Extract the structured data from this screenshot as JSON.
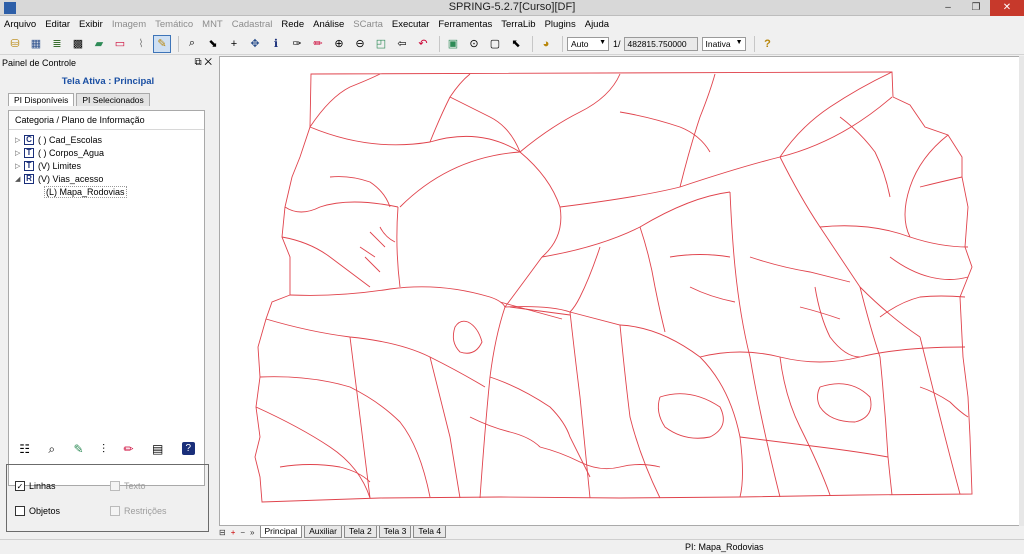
{
  "window": {
    "title": "SPRING-5.2.7[Curso][DF]",
    "min": "–",
    "max": "❐",
    "close": "✕"
  },
  "menu": [
    {
      "label": "Arquivo",
      "enabled": true
    },
    {
      "label": "Editar",
      "enabled": true
    },
    {
      "label": "Exibir",
      "enabled": true
    },
    {
      "label": "Imagem",
      "enabled": false
    },
    {
      "label": "Temático",
      "enabled": false
    },
    {
      "label": "MNT",
      "enabled": false
    },
    {
      "label": "Cadastral",
      "enabled": false
    },
    {
      "label": "Rede",
      "enabled": true
    },
    {
      "label": "Análise",
      "enabled": true
    },
    {
      "label": "SCarta",
      "enabled": false
    },
    {
      "label": "Executar",
      "enabled": true
    },
    {
      "label": "Ferramentas",
      "enabled": true
    },
    {
      "label": "TerraLib",
      "enabled": true
    },
    {
      "label": "Plugins",
      "enabled": true
    },
    {
      "label": "Ajuda",
      "enabled": true
    }
  ],
  "toolbar": {
    "scale_mode": "Auto",
    "scale_prefix": "1/",
    "scale_value": "482815.750000",
    "cursor_mode": "Inativa"
  },
  "panel": {
    "title": "Painel de Controle",
    "active_label": "Tela Ativa : Principal",
    "tabs": [
      "PI Disponíveis",
      "PI Selecionados"
    ],
    "tree_header": "Categoria / Plano de Informação",
    "categories": [
      {
        "marker": "C",
        "label": "( ) Cad_Escolas"
      },
      {
        "marker": "T",
        "label": "( ) Corpos_Agua"
      },
      {
        "marker": "T",
        "label": "(V) Limites"
      },
      {
        "marker": "R",
        "label": "(V) Vias_acesso"
      }
    ],
    "child_plan": "(L) Mapa_Rodovias",
    "options": {
      "linhas": "Linhas",
      "objetos": "Objetos",
      "texto": "Texto",
      "restricoes": "Restrições"
    }
  },
  "screens": [
    "Principal",
    "Auxiliar",
    "Tela 2",
    "Tela 3",
    "Tela 4"
  ],
  "status": {
    "pi": "PI: Mapa_Rodovias"
  },
  "colors": {
    "map_lines": "#e0434c",
    "accent": "#1a4fa3"
  }
}
